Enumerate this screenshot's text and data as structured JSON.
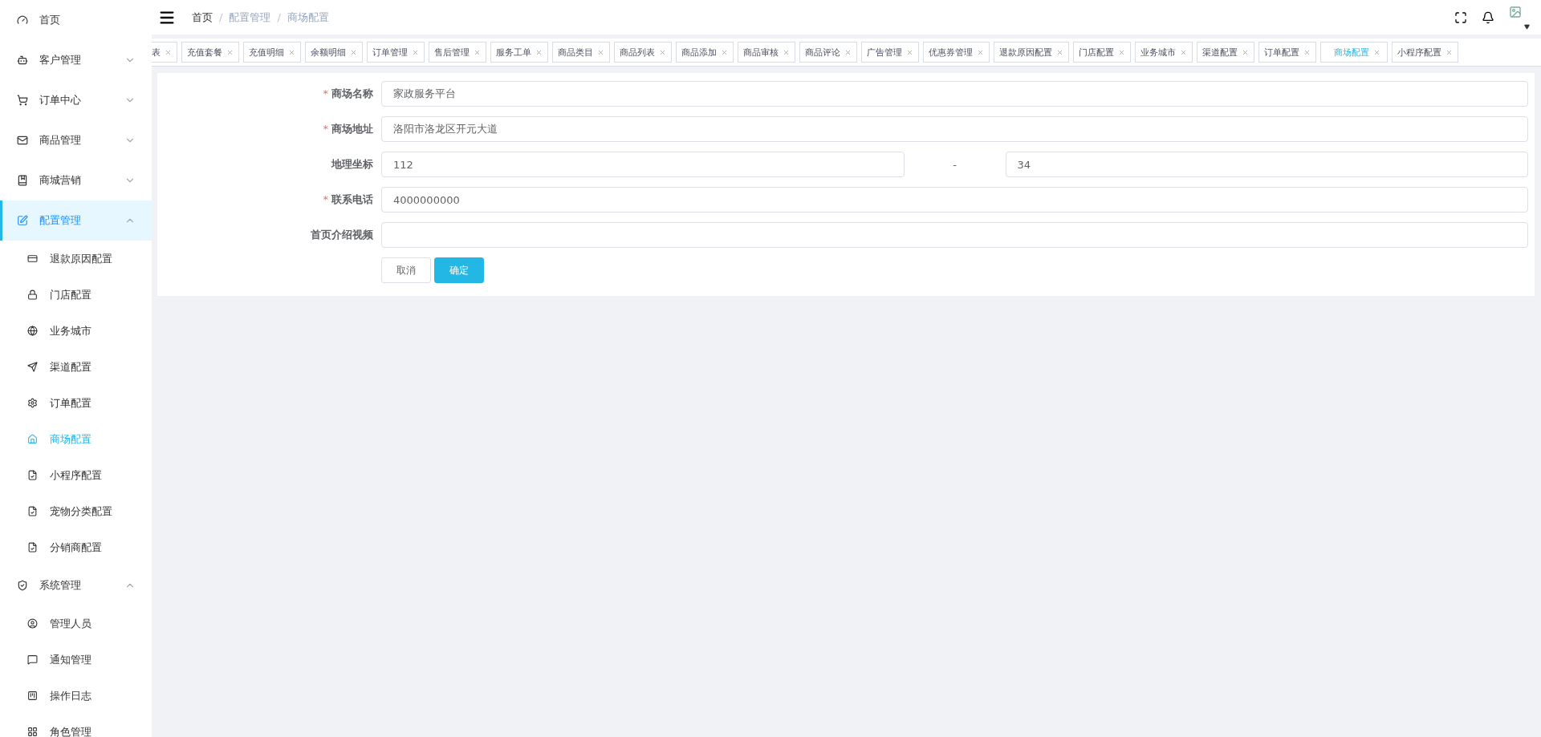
{
  "sidebar": {
    "items": [
      {
        "label": "首页",
        "selected": false
      },
      {
        "label": "客户管理",
        "expanded": false
      },
      {
        "label": "订单中心",
        "expanded": false
      },
      {
        "label": "商品管理",
        "expanded": false
      },
      {
        "label": "商城营销",
        "expanded": false
      },
      {
        "label": "配置管理",
        "expanded": true,
        "children": [
          {
            "label": "退款原因配置",
            "selected": false
          },
          {
            "label": "门店配置",
            "selected": false
          },
          {
            "label": "业务城市",
            "selected": false
          },
          {
            "label": "渠道配置",
            "selected": false
          },
          {
            "label": "订单配置",
            "selected": false
          },
          {
            "label": "商场配置",
            "selected": true
          },
          {
            "label": "小程序配置",
            "selected": false
          },
          {
            "label": "宠物分类配置",
            "selected": false
          },
          {
            "label": "分销商配置",
            "selected": false
          }
        ]
      },
      {
        "label": "系统管理",
        "expanded": true,
        "children": [
          {
            "label": "管理人员",
            "selected": false
          },
          {
            "label": "通知管理",
            "selected": false
          },
          {
            "label": "操作日志",
            "selected": false
          },
          {
            "label": "角色管理",
            "selected": false
          }
        ]
      }
    ]
  },
  "breadcrumb": {
    "separator": "/",
    "items": [
      "首页",
      "配置管理",
      "商场配置"
    ]
  },
  "tags": [
    {
      "label": "表",
      "selected": false
    },
    {
      "label": "充值套餐",
      "selected": false
    },
    {
      "label": "充值明细",
      "selected": false
    },
    {
      "label": "余额明细",
      "selected": false
    },
    {
      "label": "订单管理",
      "selected": false
    },
    {
      "label": "售后管理",
      "selected": false
    },
    {
      "label": "服务工单",
      "selected": false
    },
    {
      "label": "商品类目",
      "selected": false
    },
    {
      "label": "商品列表",
      "selected": false
    },
    {
      "label": "商品添加",
      "selected": false
    },
    {
      "label": "商品审核",
      "selected": false
    },
    {
      "label": "商品评论",
      "selected": false
    },
    {
      "label": "广告管理",
      "selected": false
    },
    {
      "label": "优惠券管理",
      "selected": false
    },
    {
      "label": "退款原因配置",
      "selected": false
    },
    {
      "label": "门店配置",
      "selected": false
    },
    {
      "label": "业务城市",
      "selected": false
    },
    {
      "label": "渠道配置",
      "selected": false
    },
    {
      "label": "订单配置",
      "selected": false
    },
    {
      "label": "商场配置",
      "selected": true
    },
    {
      "label": "小程序配置",
      "selected": false
    }
  ],
  "form": {
    "required_mark": "*",
    "fields": [
      {
        "kind": "text",
        "label": "商场名称",
        "required": true,
        "value": "家政服务平台"
      },
      {
        "kind": "text",
        "label": "商场地址",
        "required": true,
        "value": "洛阳市洛龙区开元大道"
      },
      {
        "kind": "range",
        "label": "地理坐标",
        "required": false,
        "value": "112",
        "separator": "-",
        "value2": "34"
      },
      {
        "kind": "text",
        "label": "联系电话",
        "required": true,
        "value": "4000000000"
      },
      {
        "kind": "text",
        "label": "首页介绍视频",
        "required": false
      }
    ],
    "buttons": [
      {
        "label": "取消",
        "kind": "default"
      },
      {
        "label": "确定",
        "kind": "primary"
      }
    ]
  }
}
